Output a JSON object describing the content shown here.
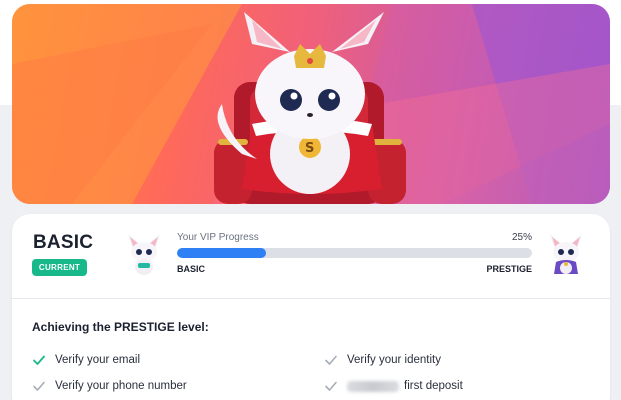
{
  "vip": {
    "current_level": "BASIC",
    "current_badge": "CURRENT",
    "progress_title": "Your VIP Progress",
    "progress_percent_label": "25%",
    "progress_fraction": 0.25,
    "from_level": "BASIC",
    "to_level": "PRESTIGE"
  },
  "requirements": {
    "heading": "Achieving the PRESTIGE level:",
    "items": [
      {
        "label": "Verify your email",
        "done": true
      },
      {
        "label": "Verify your identity",
        "done": false
      },
      {
        "label": "Verify your phone number",
        "done": false
      },
      {
        "label": "first deposit",
        "done": false
      }
    ]
  },
  "colors": {
    "accent_blue": "#2f80f5",
    "current_green": "#17b88a",
    "done_check": "#17b88a",
    "pending_check": "#a8adb8"
  },
  "icons": {
    "banner": "fox-king-mascot",
    "left_avatar": "fox-mascot-basic",
    "right_avatar": "fox-mascot-prestige",
    "check": "checkmark-icon"
  }
}
